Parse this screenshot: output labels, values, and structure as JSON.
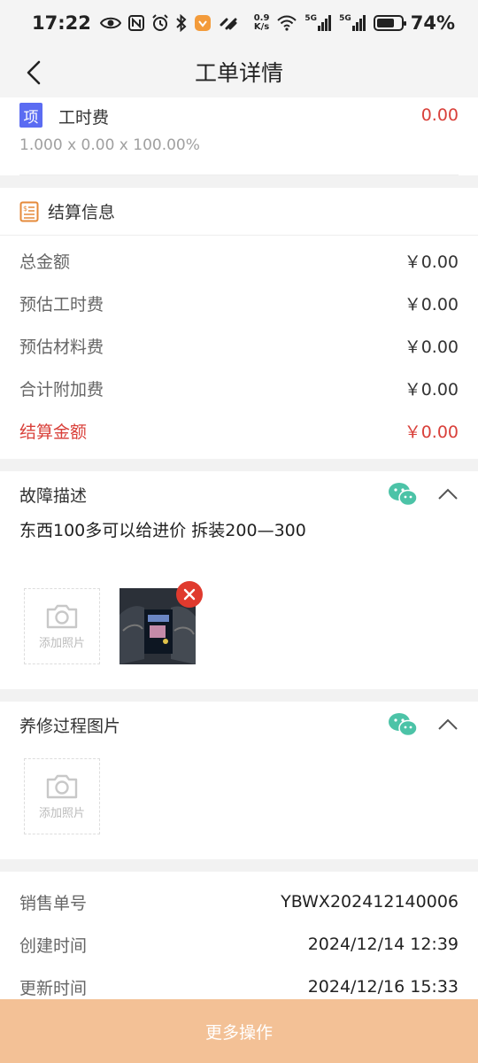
{
  "status_bar": {
    "time": "17:22",
    "net_speed_value": "0.9",
    "net_speed_unit": "K/s",
    "signal1": "5G",
    "signal2": "5G",
    "battery": "74%",
    "battery_level": 0.74
  },
  "header": {
    "title": "工单详情"
  },
  "item": {
    "tag": "项",
    "name": "工时费",
    "price": "0.00",
    "formula": "1.000 x 0.00 x 100.00%"
  },
  "settlement": {
    "title": "结算信息",
    "rows": [
      {
        "label": "总金额",
        "value": "￥0.00"
      },
      {
        "label": "预估工时费",
        "value": "￥0.00"
      },
      {
        "label": "预估材料费",
        "value": "￥0.00"
      },
      {
        "label": "合计附加费",
        "value": "￥0.00"
      },
      {
        "label": "结算金额",
        "value": "￥0.00"
      }
    ]
  },
  "fault": {
    "title": "故障描述",
    "description": "东西100多可以给进价  拆装200—300",
    "add_photo_label": "添加照片"
  },
  "process": {
    "title": "养修过程图片",
    "add_photo_label": "添加照片"
  },
  "info": {
    "rows": [
      {
        "label": "销售单号",
        "value": "YBWX202412140006"
      },
      {
        "label": "创建时间",
        "value": "2024/12/14 12:39"
      },
      {
        "label": "更新时间",
        "value": "2024/12/16 15:33"
      }
    ]
  },
  "footer": {
    "button_label": "更多操作"
  },
  "colors": {
    "accent_red": "#d9403a",
    "tag_blue": "#5b6cf2",
    "button_orange": "#f3c196",
    "wechat_green": "#4cc3a7"
  }
}
